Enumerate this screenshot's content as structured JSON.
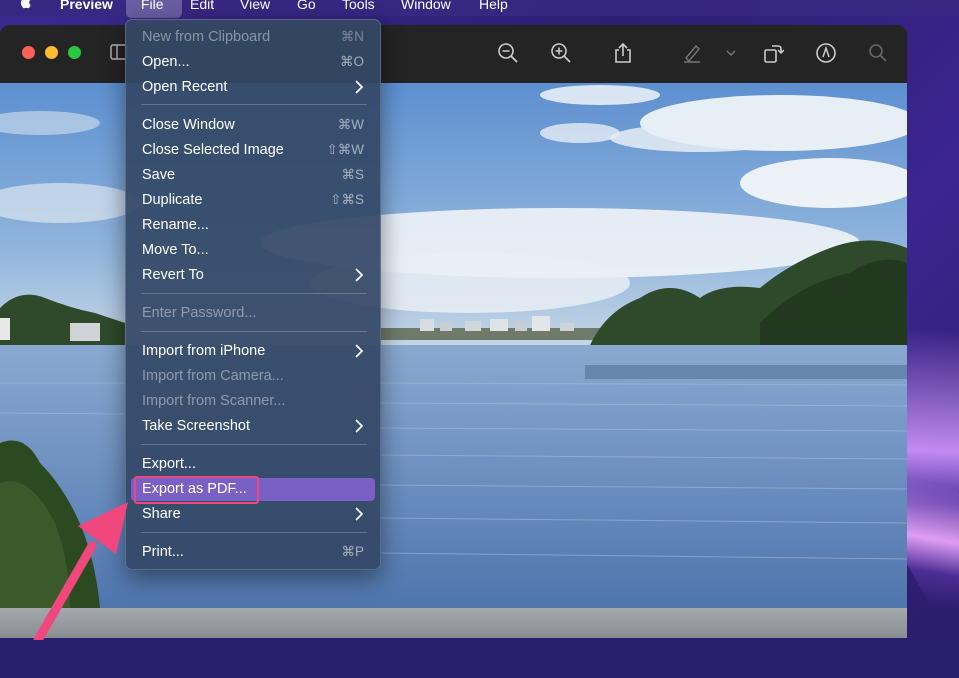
{
  "menubar": {
    "app_name": "Preview",
    "items": [
      "File",
      "Edit",
      "View",
      "Go",
      "Tools",
      "Window",
      "Help"
    ]
  },
  "toolbar": {
    "icons": [
      "sidebar-icon",
      "zoom-out-icon",
      "zoom-in-icon",
      "share-icon",
      "highlight-pen-icon",
      "chevron-down-icon",
      "rotate-icon",
      "markup-icon",
      "search-icon"
    ]
  },
  "file_menu": {
    "new_from_clipboard": {
      "label": "New from Clipboard",
      "shortcut": "⌘N"
    },
    "open": {
      "label": "Open...",
      "shortcut": "⌘O"
    },
    "open_recent": {
      "label": "Open Recent"
    },
    "close_window": {
      "label": "Close Window",
      "shortcut": "⌘W"
    },
    "close_selected_image": {
      "label": "Close Selected Image",
      "shortcut": "⇧⌘W"
    },
    "save": {
      "label": "Save",
      "shortcut": "⌘S"
    },
    "duplicate": {
      "label": "Duplicate",
      "shortcut": "⇧⌘S"
    },
    "rename": {
      "label": "Rename..."
    },
    "move_to": {
      "label": "Move To..."
    },
    "revert_to": {
      "label": "Revert To"
    },
    "enter_password": {
      "label": "Enter Password..."
    },
    "import_from_iphone": {
      "label": "Import from iPhone"
    },
    "import_from_camera": {
      "label": "Import from Camera..."
    },
    "import_from_scanner": {
      "label": "Import from Scanner..."
    },
    "take_screenshot": {
      "label": "Take Screenshot"
    },
    "export": {
      "label": "Export..."
    },
    "export_as_pdf": {
      "label": "Export as PDF..."
    },
    "share": {
      "label": "Share"
    },
    "print": {
      "label": "Print...",
      "shortcut": "⌘P"
    }
  },
  "colors": {
    "highlight": "#7a5fc4",
    "annotation": "#f0487c"
  }
}
